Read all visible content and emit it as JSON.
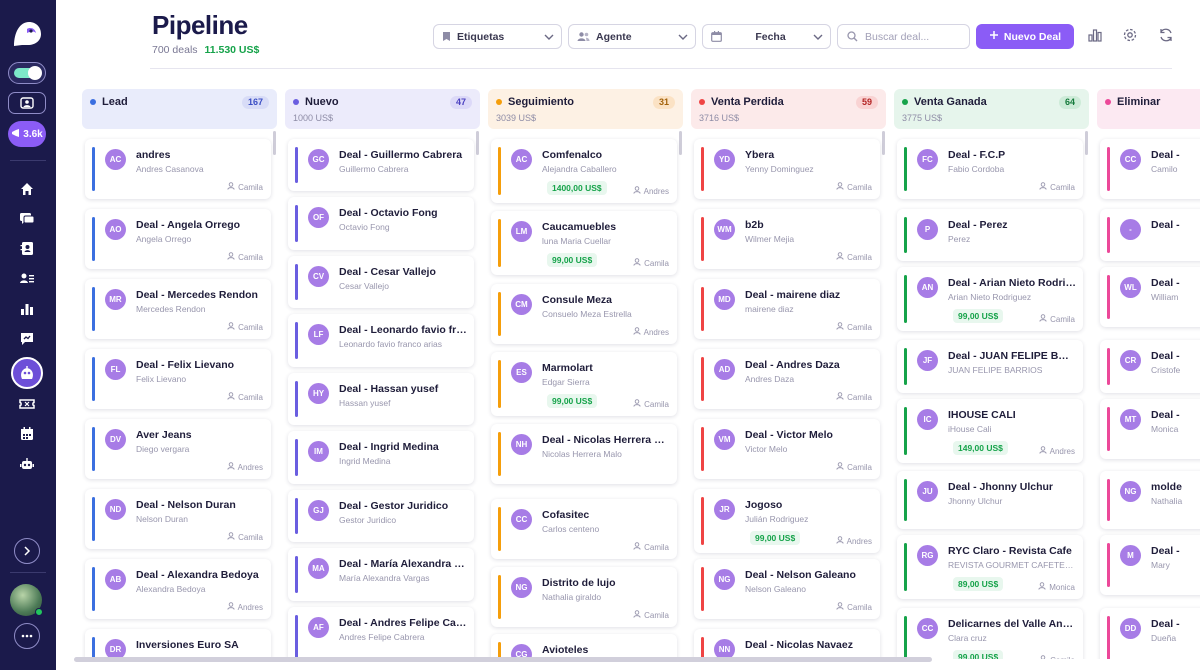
{
  "sidebar": {
    "badge_count": "3.6k",
    "nav_icons": [
      "home-icon",
      "chat-icon",
      "contacts-icon",
      "user-list-icon",
      "chart-icon",
      "reports-icon",
      "pipeline-icon",
      "ticket-icon",
      "calendar-icon",
      "bot-icon"
    ],
    "active_item": "pipeline-icon"
  },
  "header": {
    "title": "Pipeline",
    "deals_count": "700 deals",
    "total_amount": "11.530 US$",
    "filters": {
      "tags": "Etiquetas",
      "agent": "Agente",
      "date": "Fecha"
    },
    "search_placeholder": "Buscar deal...",
    "new_deal_label": "Nuevo Deal"
  },
  "colors": {
    "brand": "#8b5cf6",
    "sidebar_bg": "#1b1a4b",
    "money_green": "#16a34a"
  },
  "columns": [
    {
      "name": "Lead",
      "count": "167",
      "total": "",
      "color": "#3b6fe0",
      "head_bg": "#e9ecfb",
      "count_bg": "#d8dcf7",
      "count_color": "#3b4ec4",
      "cards": [
        {
          "initials": "AC",
          "title": "andres",
          "subtitle": "Andres Casanova",
          "amount": "",
          "agent": "Camila"
        },
        {
          "initials": "AO",
          "title": "Deal - Angela Orrego",
          "subtitle": "Angela Orrego",
          "amount": "",
          "agent": "Camila"
        },
        {
          "initials": "MR",
          "title": "Deal - Mercedes Rendon",
          "subtitle": "Mercedes Rendon",
          "amount": "",
          "agent": "Camila"
        },
        {
          "initials": "FL",
          "title": "Deal - Felix Lievano",
          "subtitle": "Felix Lievano",
          "amount": "",
          "agent": "Camila"
        },
        {
          "initials": "DV",
          "title": "Aver Jeans",
          "subtitle": "Diego vergara",
          "amount": "",
          "agent": "Andres"
        },
        {
          "initials": "ND",
          "title": "Deal - Nelson Duran",
          "subtitle": "Nelson Duran",
          "amount": "",
          "agent": "Camila"
        },
        {
          "initials": "AB",
          "title": "Deal - Alexandra Bedoya",
          "subtitle": "Alexandra Bedoya",
          "amount": "",
          "agent": "Andres"
        },
        {
          "initials": "DR",
          "title": "Inversiones Euro SA",
          "subtitle": "",
          "amount": "",
          "agent": ""
        }
      ]
    },
    {
      "name": "Nuevo",
      "count": "47",
      "total": "1000 US$",
      "color": "#6a5ee0",
      "head_bg": "#ecebfb",
      "count_bg": "#dcd9f8",
      "count_color": "#4a3fc0",
      "cards": [
        {
          "initials": "GC",
          "title": "Deal - Guillermo Cabrera",
          "subtitle": "Guillermo Cabrera",
          "amount": "",
          "agent": ""
        },
        {
          "initials": "OF",
          "title": "Deal - Octavio Fong",
          "subtitle": "Octavio Fong",
          "amount": "",
          "agent": ""
        },
        {
          "initials": "CV",
          "title": "Deal - Cesar Vallejo",
          "subtitle": "Cesar Vallejo",
          "amount": "",
          "agent": ""
        },
        {
          "initials": "LF",
          "title": "Deal - Leonardo favio franco arias",
          "subtitle": "Leonardo favio franco arias",
          "amount": "",
          "agent": ""
        },
        {
          "initials": "HY",
          "title": "Deal - Hassan yusef",
          "subtitle": "Hassan yusef",
          "amount": "",
          "agent": ""
        },
        {
          "initials": "IM",
          "title": "Deal - Ingrid Medina",
          "subtitle": "Ingrid Medina",
          "amount": "",
          "agent": ""
        },
        {
          "initials": "GJ",
          "title": "Deal - Gestor Juridico",
          "subtitle": "Gestor Juridico",
          "amount": "",
          "agent": ""
        },
        {
          "initials": "MA",
          "title": "Deal - María Alexandra Vargas",
          "subtitle": "María Alexandra Vargas",
          "amount": "",
          "agent": ""
        },
        {
          "initials": "AF",
          "title": "Deal - Andres Felipe Cabrera",
          "subtitle": "Andres Felipe Cabrera",
          "amount": "",
          "agent": ""
        }
      ]
    },
    {
      "name": "Seguimiento",
      "count": "31",
      "total": "3039 US$",
      "color": "#f59e0b",
      "head_bg": "#fdf1e4",
      "count_bg": "#fbe2c4",
      "count_color": "#a3620a",
      "cards": [
        {
          "initials": "AC",
          "title": "Comfenalco",
          "subtitle": "Alejandra Caballero",
          "amount": "1400,00 US$",
          "agent": "Andres"
        },
        {
          "initials": "LM",
          "title": "Caucamuebles",
          "subtitle": "luna Maria Cuellar",
          "amount": "99,00 US$",
          "agent": "Camila"
        },
        {
          "initials": "CM",
          "title": "Consule Meza",
          "subtitle": "Consuelo Meza Estrella",
          "amount": "",
          "agent": "Andres"
        },
        {
          "initials": "ES",
          "title": "Marmolart",
          "subtitle": "Edgar Sierra",
          "amount": "99,00 US$",
          "agent": "Camila"
        },
        {
          "initials": "NH",
          "title": "Deal - Nicolas Herrera Malo",
          "subtitle": "Nicolas Herrera Malo",
          "amount": "",
          "agent": ""
        },
        {
          "initials": "CC",
          "title": "Cofasitec",
          "subtitle": "Carlos centeno",
          "amount": "",
          "agent": "Camila"
        },
        {
          "initials": "NG",
          "title": "Distrito de lujo",
          "subtitle": "Nathalia giraldo",
          "amount": "",
          "agent": "Camila"
        },
        {
          "initials": "CG",
          "title": "Avioteles",
          "subtitle": "",
          "amount": "",
          "agent": ""
        }
      ]
    },
    {
      "name": "Venta Perdida",
      "count": "59",
      "total": "3716 US$",
      "color": "#ef4444",
      "head_bg": "#fceaea",
      "count_bg": "#f9d3d3",
      "count_color": "#b42323",
      "cards": [
        {
          "initials": "YD",
          "title": "Ybera",
          "subtitle": "Yenny Dominguez",
          "amount": "",
          "agent": "Camila"
        },
        {
          "initials": "WM",
          "title": "b2b",
          "subtitle": "Wilmer Mejia",
          "amount": "",
          "agent": "Camila"
        },
        {
          "initials": "MD",
          "title": "Deal - mairene diaz",
          "subtitle": "mairene diaz",
          "amount": "",
          "agent": "Camila"
        },
        {
          "initials": "AD",
          "title": "Deal - Andres Daza",
          "subtitle": "Andres Daza",
          "amount": "",
          "agent": "Camila"
        },
        {
          "initials": "VM",
          "title": "Deal - Victor Melo",
          "subtitle": "Victor Melo",
          "amount": "",
          "agent": "Camila"
        },
        {
          "initials": "JR",
          "title": "Jogoso",
          "subtitle": "Julián Rodriguez",
          "amount": "99,00 US$",
          "agent": "Andres"
        },
        {
          "initials": "NG",
          "title": "Deal - Nelson Galeano",
          "subtitle": "Nelson Galeano",
          "amount": "",
          "agent": "Camila"
        },
        {
          "initials": "NN",
          "title": "Deal - Nicolas Navaez",
          "subtitle": "",
          "amount": "",
          "agent": ""
        }
      ]
    },
    {
      "name": "Venta Ganada",
      "count": "64",
      "total": "3775 US$",
      "color": "#16a34a",
      "head_bg": "#e6f5ec",
      "count_bg": "#cdebd8",
      "count_color": "#157a3b",
      "cards": [
        {
          "initials": "FC",
          "title": "Deal - F.C.P",
          "subtitle": "Fabio Cordoba",
          "amount": "",
          "agent": "Camila"
        },
        {
          "initials": "P",
          "title": "Deal - Perez",
          "subtitle": "Perez",
          "amount": "",
          "agent": ""
        },
        {
          "initials": "AN",
          "title": "Deal - Arian Nieto Rodriguez",
          "subtitle": "Arian Nieto Rodriguez",
          "amount": "99,00 US$",
          "agent": "Camila"
        },
        {
          "initials": "JF",
          "title": "Deal - JUAN FELIPE BARRIOS",
          "subtitle": "JUAN FELIPE BARRIOS",
          "amount": "",
          "agent": ""
        },
        {
          "initials": "IC",
          "title": "IHOUSE CALI",
          "subtitle": "iHouse Cali",
          "amount": "149,00 US$",
          "agent": "Andres"
        },
        {
          "initials": "JU",
          "title": "Deal - Jhonny Ulchur",
          "subtitle": "Jhonny Ulchur",
          "amount": "",
          "agent": ""
        },
        {
          "initials": "RG",
          "title": "RYC Claro - Revista Cafe",
          "subtitle": "REVISTA GOURMET CAFETERO",
          "amount": "89,00 US$",
          "agent": "Monica"
        },
        {
          "initials": "CC",
          "title": "Delicarnes del Valle Ancla",
          "subtitle": "Clara cruz",
          "amount": "99,00 US$",
          "agent": "Camila"
        }
      ]
    },
    {
      "name": "Eliminar",
      "count": "",
      "total": "",
      "color": "#ec4899",
      "head_bg": "#fce9f2",
      "count_bg": "#f9d3e6",
      "count_color": "#a8246b",
      "cards": [
        {
          "initials": "CC",
          "title": "Deal -",
          "subtitle": "Camilo",
          "amount": "",
          "agent": ""
        },
        {
          "initials": "-",
          "title": "Deal -",
          "subtitle": "",
          "amount": "",
          "agent": ""
        },
        {
          "initials": "WL",
          "title": "Deal -",
          "subtitle": "William",
          "amount": "",
          "agent": ""
        },
        {
          "initials": "CR",
          "title": "Deal -",
          "subtitle": "Cristofe",
          "amount": "",
          "agent": ""
        },
        {
          "initials": "MT",
          "title": "Deal -",
          "subtitle": "Monica",
          "amount": "",
          "agent": ""
        },
        {
          "initials": "NG",
          "title": "molde",
          "subtitle": "Nathalia",
          "amount": "",
          "agent": ""
        },
        {
          "initials": "M",
          "title": "Deal -",
          "subtitle": "Mary",
          "amount": "",
          "agent": ""
        },
        {
          "initials": "DD",
          "title": "Deal -",
          "subtitle": "Dueña",
          "amount": "",
          "agent": ""
        }
      ]
    }
  ]
}
